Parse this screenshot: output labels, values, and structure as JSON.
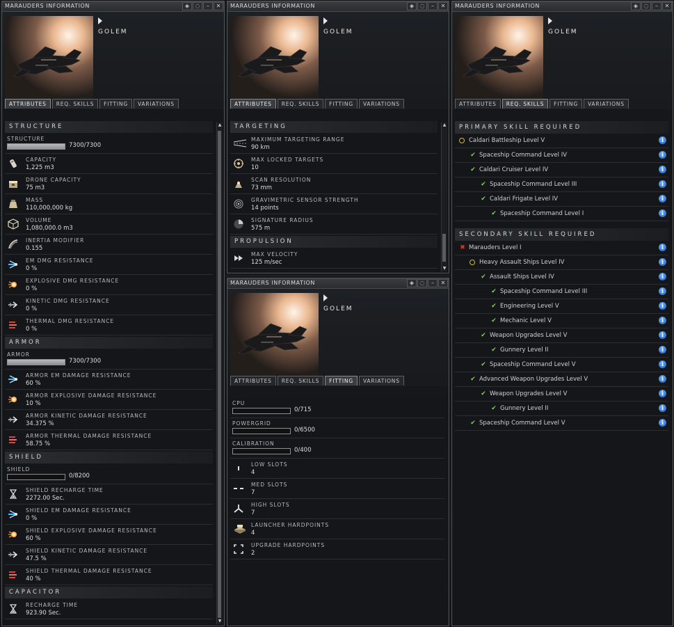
{
  "window_title": "MARAUDERS INFORMATION",
  "ship_name": "GOLEM",
  "title_buttons": [
    "◈",
    "◌",
    "–",
    "✕"
  ],
  "tabs": [
    "ATTRIBUTES",
    "REQ. SKILLS",
    "FITTING",
    "VARIATIONS"
  ],
  "attributes": {
    "structure_header": "STRUCTURE",
    "structure_label": "STRUCTURE",
    "structure_value": "7300/7300",
    "structure_fill": 1.0,
    "structure_rows": [
      {
        "label": "CAPACITY",
        "value": "1,225 m3",
        "icon": "cargo-icon"
      },
      {
        "label": "DRONE CAPACITY",
        "value": "75 m3",
        "icon": "drone-bay-icon"
      },
      {
        "label": "MASS",
        "value": "110,000,000 kg",
        "icon": "mass-icon"
      },
      {
        "label": "VOLUME",
        "value": "1,080,000.0 m3",
        "icon": "volume-cube-icon"
      },
      {
        "label": "INERTIA MODIFIER",
        "value": "0.155",
        "icon": "inertia-icon"
      },
      {
        "label": "EM DMG RESISTANCE",
        "value": "0 %",
        "icon": "em-resistance-icon"
      },
      {
        "label": "EXPLOSIVE DMG RESISTANCE",
        "value": "0 %",
        "icon": "explosive-resistance-icon"
      },
      {
        "label": "KINETIC DMG RESISTANCE",
        "value": "0 %",
        "icon": "kinetic-resistance-icon"
      },
      {
        "label": "THERMAL DMG RESISTANCE",
        "value": "0 %",
        "icon": "thermal-resistance-icon"
      }
    ],
    "armor_header": "ARMOR",
    "armor_label": "ARMOR",
    "armor_value": "7300/7300",
    "armor_fill": 1.0,
    "armor_rows": [
      {
        "label": "ARMOR EM DAMAGE RESISTANCE",
        "value": "60 %",
        "icon": "em-resistance-icon"
      },
      {
        "label": "ARMOR EXPLOSIVE DAMAGE RESISTANCE",
        "value": "10 %",
        "icon": "explosive-resistance-icon"
      },
      {
        "label": "ARMOR KINETIC DAMAGE RESISTANCE",
        "value": "34.375 %",
        "icon": "kinetic-resistance-icon"
      },
      {
        "label": "ARMOR THERMAL DAMAGE RESISTANCE",
        "value": "58.75 %",
        "icon": "thermal-resistance-icon"
      }
    ],
    "shield_header": "SHIELD",
    "shield_label": "SHIELD",
    "shield_value": "0/8200",
    "shield_fill": 0.0,
    "shield_rows": [
      {
        "label": "SHIELD RECHARGE TIME",
        "value": "2272.00 Sec.",
        "icon": "hourglass-icon"
      },
      {
        "label": "SHIELD EM DAMAGE RESISTANCE",
        "value": "0 %",
        "icon": "em-resistance-icon"
      },
      {
        "label": "SHIELD EXPLOSIVE DAMAGE RESISTANCE",
        "value": "60 %",
        "icon": "explosive-resistance-icon"
      },
      {
        "label": "SHIELD KINETIC DAMAGE RESISTANCE",
        "value": "47.5 %",
        "icon": "kinetic-resistance-icon"
      },
      {
        "label": "SHIELD THERMAL DAMAGE RESISTANCE",
        "value": "40 %",
        "icon": "thermal-resistance-icon"
      }
    ],
    "capacitor_header": "CAPACITOR",
    "capacitor_rows": [
      {
        "label": "RECHARGE TIME",
        "value": "923.90 Sec.",
        "icon": "hourglass-icon"
      }
    ]
  },
  "targeting": {
    "header": "TARGETING",
    "rows": [
      {
        "label": "MAXIMUM TARGETING RANGE",
        "value": "90 km",
        "icon": "targeting-range-icon"
      },
      {
        "label": "MAX LOCKED TARGETS",
        "value": "10",
        "icon": "locked-targets-icon"
      },
      {
        "label": "SCAN RESOLUTION",
        "value": "73 mm",
        "icon": "scan-resolution-icon"
      },
      {
        "label": "GRAVIMETRIC SENSOR STRENGTH",
        "value": "14 points",
        "icon": "gravimetric-sensor-icon"
      },
      {
        "label": "SIGNATURE RADIUS",
        "value": "575 m",
        "icon": "signature-radius-icon"
      }
    ],
    "propulsion_header": "PROPULSION",
    "propulsion_rows": [
      {
        "label": "MAX VELOCITY",
        "value": "125 m/sec",
        "icon": "velocity-icon"
      }
    ]
  },
  "fitting": {
    "bars": [
      {
        "label": "CPU",
        "value": "0/715",
        "fill": 0.0
      },
      {
        "label": "POWERGRID",
        "value": "0/6500",
        "fill": 0.0
      },
      {
        "label": "CALIBRATION",
        "value": "0/400",
        "fill": 0.0
      }
    ],
    "rows": [
      {
        "label": "LOW SLOTS",
        "value": "4",
        "icon": "low-slot-icon"
      },
      {
        "label": "MED SLOTS",
        "value": "7",
        "icon": "med-slot-icon"
      },
      {
        "label": "HIGH SLOTS",
        "value": "7",
        "icon": "high-slot-icon"
      },
      {
        "label": "LAUNCHER HARDPOINTS",
        "value": "4",
        "icon": "launcher-hardpoint-icon"
      },
      {
        "label": "UPGRADE HARDPOINTS",
        "value": "2",
        "icon": "upgrade-hardpoint-icon"
      }
    ]
  },
  "skills": {
    "primary_header": "PRIMARY SKILL REQUIRED",
    "primary": [
      {
        "text": "Caldari Battleship Level V",
        "indent": 0,
        "status": "ring"
      },
      {
        "text": "Spaceship Command Level IV",
        "indent": 1,
        "status": "check"
      },
      {
        "text": "Caldari Cruiser Level IV",
        "indent": 1,
        "status": "check"
      },
      {
        "text": "Spaceship Command Level III",
        "indent": 2,
        "status": "check"
      },
      {
        "text": "Caldari Frigate Level IV",
        "indent": 2,
        "status": "check"
      },
      {
        "text": "Spaceship Command Level I",
        "indent": 3,
        "status": "check"
      }
    ],
    "secondary_header": "SECONDARY SKILL REQUIRED",
    "secondary": [
      {
        "text": "Marauders Level I",
        "indent": 0,
        "status": "x"
      },
      {
        "text": "Heavy Assault Ships Level IV",
        "indent": 1,
        "status": "ring"
      },
      {
        "text": "Assault Ships Level IV",
        "indent": 2,
        "status": "check"
      },
      {
        "text": "Spaceship Command Level III",
        "indent": 3,
        "status": "check"
      },
      {
        "text": "Engineering Level V",
        "indent": 3,
        "status": "check"
      },
      {
        "text": "Mechanic Level V",
        "indent": 3,
        "status": "check"
      },
      {
        "text": "Weapon Upgrades Level V",
        "indent": 2,
        "status": "check"
      },
      {
        "text": "Gunnery Level II",
        "indent": 3,
        "status": "check"
      },
      {
        "text": "Spaceship Command Level V",
        "indent": 2,
        "status": "check"
      },
      {
        "text": "Advanced Weapon Upgrades Level V",
        "indent": 1,
        "status": "check"
      },
      {
        "text": "Weapon Upgrades Level V",
        "indent": 2,
        "status": "check"
      },
      {
        "text": "Gunnery Level II",
        "indent": 3,
        "status": "check"
      },
      {
        "text": "Spaceship Command Level V",
        "indent": 1,
        "status": "check"
      }
    ],
    "info_glyph": "i"
  }
}
